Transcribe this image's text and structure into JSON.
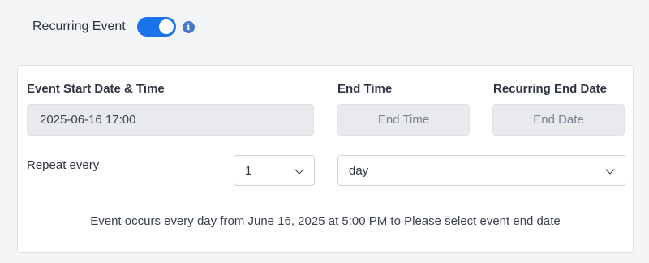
{
  "recurring": {
    "label": "Recurring Event",
    "enabled": true,
    "info_icon": "info-icon"
  },
  "form": {
    "start_label": "Event Start Date & Time",
    "start_value": "2025-06-16 17:00",
    "end_time_label": "End Time",
    "end_time_placeholder": "End Time",
    "recurring_end_label": "Recurring End Date",
    "recurring_end_placeholder": "End Date",
    "repeat_label": "Repeat every",
    "repeat_count": "1",
    "repeat_unit": "day",
    "summary": "Event occurs every day from June 16, 2025 at 5:00 PM to Please select event end date"
  },
  "colors": {
    "accent": "#1a73e8",
    "field_bg": "#e8eaee",
    "page_bg": "#f4f5f7"
  }
}
